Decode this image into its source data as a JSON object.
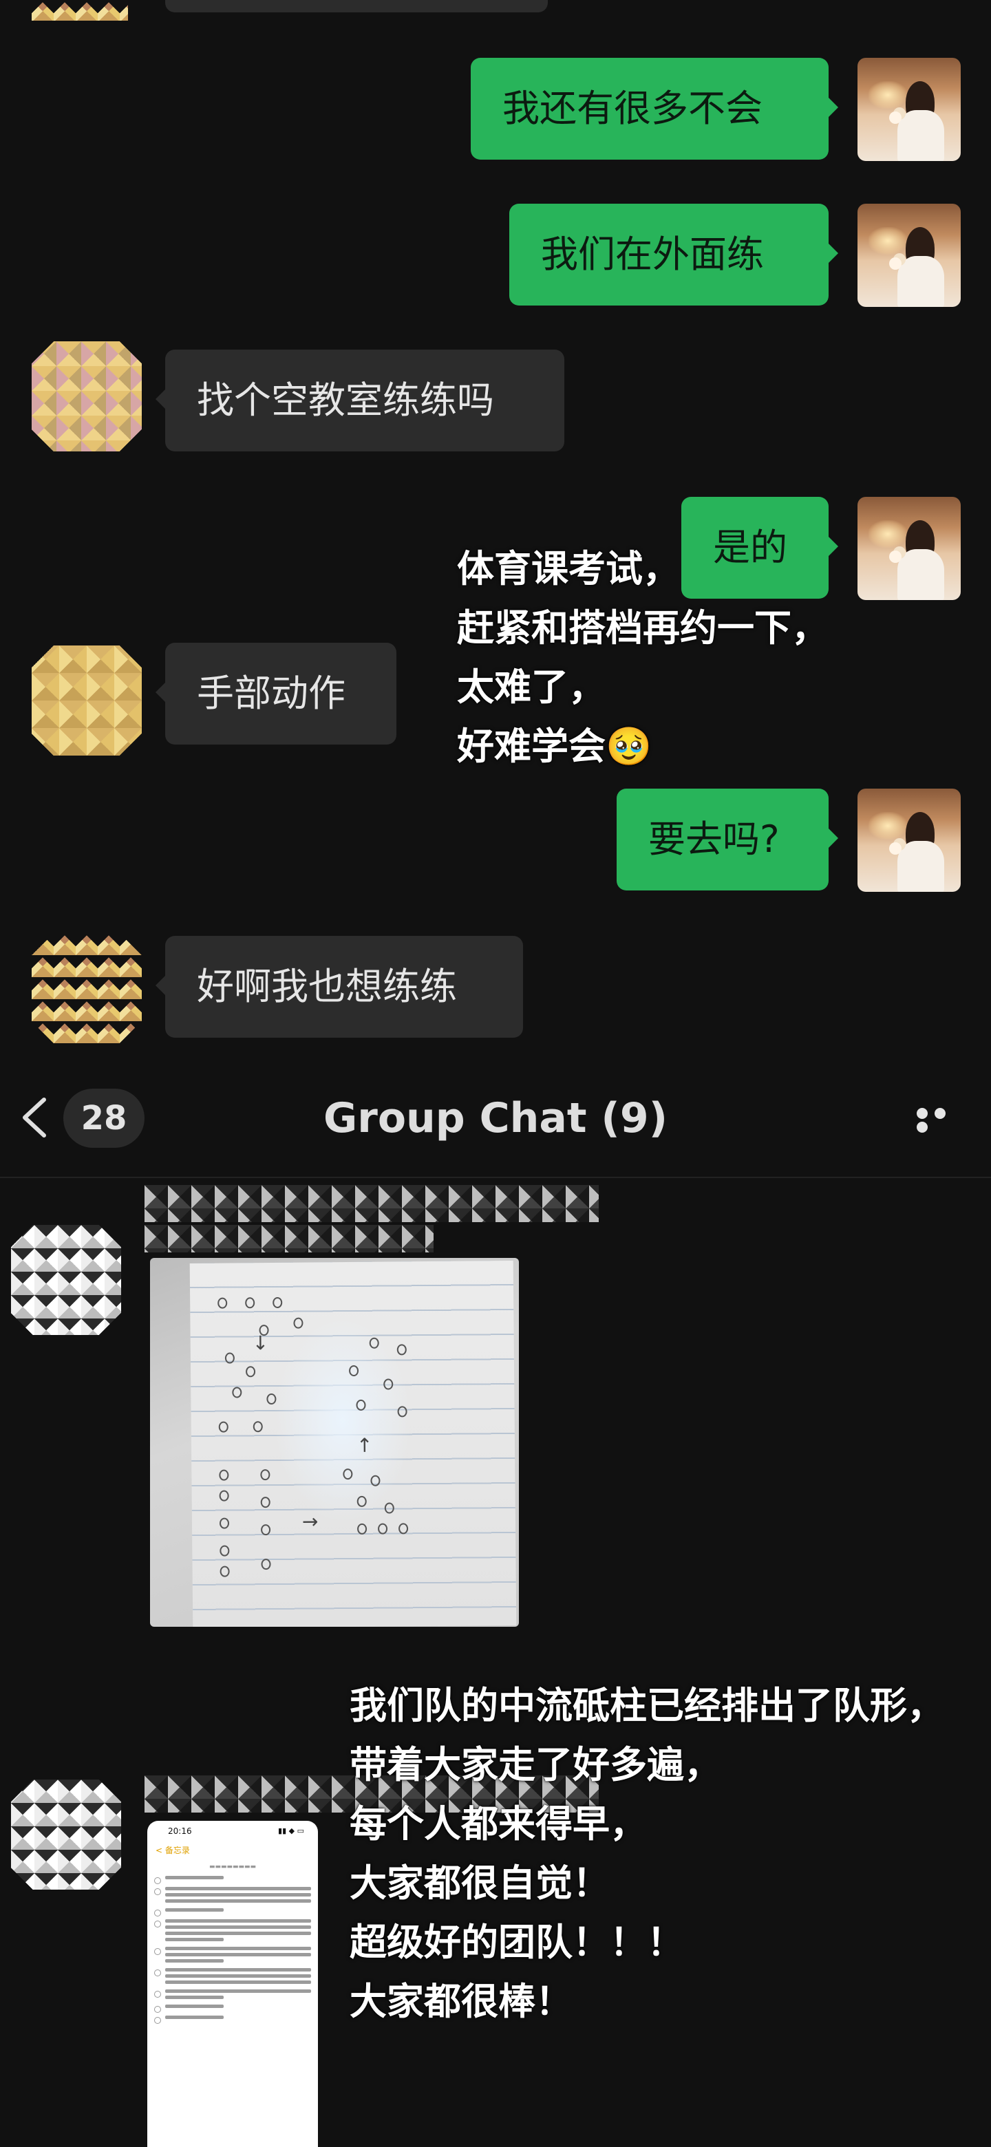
{
  "messages": [
    {
      "side": "out",
      "text": "我还有很多不会"
    },
    {
      "side": "out",
      "text": "我们在外面练"
    },
    {
      "side": "in",
      "text": "找个空教室练练吗"
    },
    {
      "side": "out",
      "text": "是的"
    },
    {
      "side": "in",
      "text": "手部动作"
    },
    {
      "side": "out",
      "text": "要去吗?"
    },
    {
      "side": "in",
      "text": "好啊我也想练练"
    }
  ],
  "caption_top": {
    "lines": [
      "体育课考试，",
      "赶紧和搭档再约一下，",
      "太难了，",
      "好难学会🥹"
    ]
  },
  "nav": {
    "back_count": "28",
    "title": "Group Chat (9)"
  },
  "caption_bottom": {
    "lines": [
      "我们队的中流砥柱已经排出了队形，",
      "带着大家走了好多遍，",
      "每个人都来得早，",
      "大家都很自觉！",
      "超级好的团队！！！",
      "大家都很棒！"
    ]
  },
  "phone_screenshot": {
    "time": "20:16",
    "back": "< 备忘录"
  },
  "colors": {
    "background": "#111111",
    "outgoing_bubble": "#28b45a",
    "incoming_bubble": "#2c2c2c"
  },
  "icons": [
    "back-chevron-icon",
    "more-icon"
  ]
}
